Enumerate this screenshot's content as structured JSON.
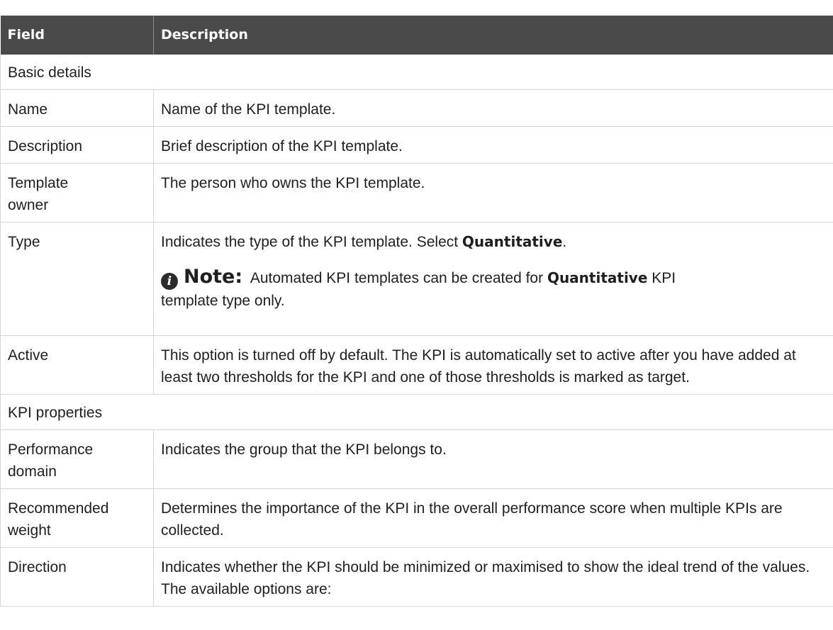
{
  "header": {
    "field": "Field",
    "description": "Description"
  },
  "sections": {
    "basic": "Basic details",
    "kpi": "KPI properties"
  },
  "rows": {
    "name": {
      "field": "Name",
      "description": "Name of the KPI template."
    },
    "description": {
      "field": "Description",
      "description": "Brief description of the KPI template."
    },
    "owner": {
      "field_line1": "Template",
      "field_line2": "owner",
      "description": "The person who owns the KPI template."
    },
    "type": {
      "field": "Type",
      "description_prefix": "Indicates the type of the KPI template. Select ",
      "description_bold": "Quantitative",
      "description_suffix": ".",
      "note_label": "Note:",
      "note_text1": "Automated KPI templates can be created for ",
      "note_bold": "Quantitative",
      "note_text2": " KPI",
      "note_text3": "template type only."
    },
    "active": {
      "field": "Active",
      "description": "This option is turned off by default. The KPI is automatically set to active after you have added at least two thresholds for the KPI and one of those thresholds is marked as target."
    },
    "performance": {
      "field_line1": "Performance",
      "field_line2": "domain",
      "description": "Indicates the group that the KPI belongs to."
    },
    "weight": {
      "field_line1": "Recommended",
      "field_line2": "weight",
      "description": "Determines the importance of the KPI in the overall performance score when multiple KPIs are collected."
    },
    "direction": {
      "field": "Direction",
      "description": "Indicates whether the KPI should be minimized or maximised to show the ideal trend of the values. The available options are:"
    }
  },
  "icons": {
    "note": "info-icon"
  }
}
